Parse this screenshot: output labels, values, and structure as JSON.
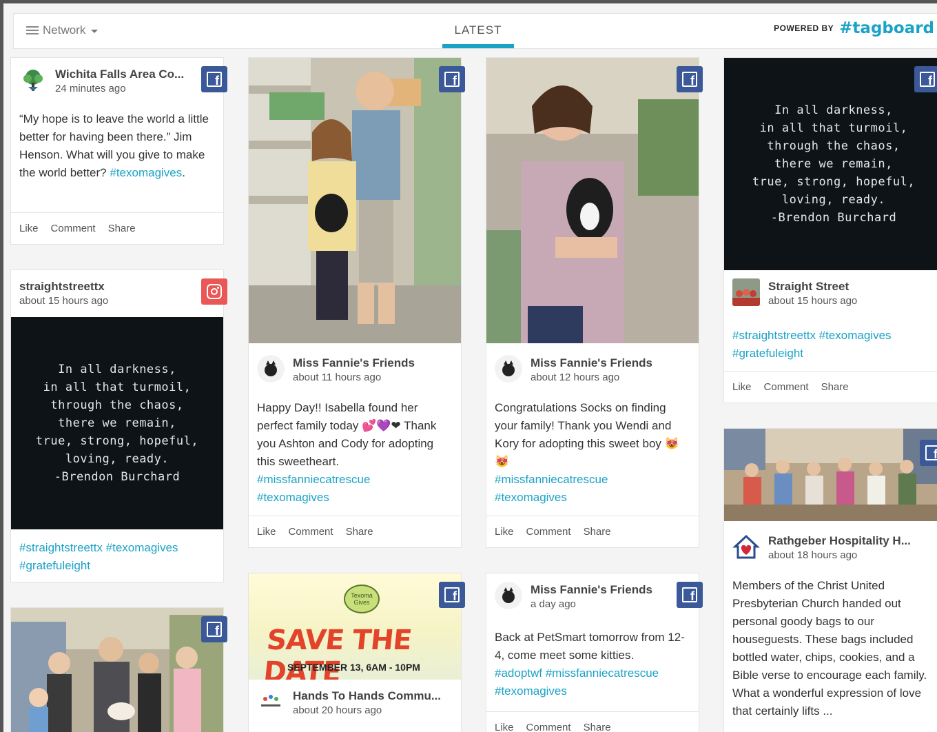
{
  "header": {
    "filter_label": "Network",
    "tab_label": "LATEST",
    "powered_by": "POWERED BY",
    "brand": "#tagboard",
    "accent_color": "#1ba3c6"
  },
  "actions": {
    "like": "Like",
    "comment": "Comment",
    "share": "Share"
  },
  "posts": {
    "wichita": {
      "network": "facebook",
      "author": "Wichita Falls Area Co...",
      "time": "24 minutes ago",
      "text": "“My hope is to leave the world a little better for having been there.” Jim Henson. What will you give to make the world better?",
      "tags": "#texomagives",
      "tail": "."
    },
    "straight_ig": {
      "network": "instagram",
      "author": "straightstreettx",
      "time": "about 15 hours ago",
      "quote": "In all darkness,\nin all that turmoil,\nthrough the chaos,\nthere we remain,\ntrue, strong, hopeful,\nloving, ready.\n-Brendon Burchard",
      "tags_line1": "#straightstreettx #texomagives",
      "tags_line2": "#gratefuleight"
    },
    "fannie_isabella": {
      "network": "facebook",
      "author": "Miss Fannie's Friends",
      "time": "about 11 hours ago",
      "text": "Happy Day!! Isabella found her perfect family today 💕💜❤ Thank you Ashton and Cody for adopting this sweetheart.",
      "tags_line1": "#missfanniecatrescue",
      "tags_line2": "#texomagives"
    },
    "save_date": {
      "network": "facebook",
      "logo_text": "Texoma Gives",
      "title": "SAVE THE DATE",
      "subtitle": "SEPTEMBER 13, 6AM - 10PM",
      "author": "Hands To Hands Commu...",
      "time": "about 20 hours ago"
    },
    "fannie_socks": {
      "network": "facebook",
      "author": "Miss Fannie's Friends",
      "time": "about 12 hours ago",
      "text": "Congratulations Socks on finding your family! Thank you Wendi and Kory for adopting this sweet boy 😻😻",
      "tags_line1": "#missfanniecatrescue",
      "tags_line2": "#texomagives"
    },
    "fannie_petsmart": {
      "network": "facebook",
      "author": "Miss Fannie's Friends",
      "time": "a day ago",
      "text": "Back at PetSmart tomorrow from 12-4, come meet some kitties.",
      "tags_line1": "#adoptwf #missfanniecatrescue",
      "tags_line2": "#texomagives"
    },
    "straight_fb": {
      "network": "facebook",
      "quote": "In all darkness,\nin all that turmoil,\nthrough the chaos,\nthere we remain,\ntrue, strong, hopeful,\nloving, ready.\n-Brendon Burchard",
      "author": "Straight Street",
      "time": "about 15 hours ago",
      "tags_line1": "#straightstreettx #texomagives",
      "tags_line2": "#gratefuleight"
    },
    "rathgeber": {
      "network": "facebook",
      "author": "Rathgeber Hospitality H...",
      "time": "about 18 hours ago",
      "text": "Members of the Christ United Presbyterian Church handed out personal goody bags to our houseguests. These bags included bottled water, chips, cookies, and a Bible verse to encourage each family. What a wonderful expression of love that certainly lifts ..."
    },
    "store_group": {
      "network": "facebook"
    }
  }
}
